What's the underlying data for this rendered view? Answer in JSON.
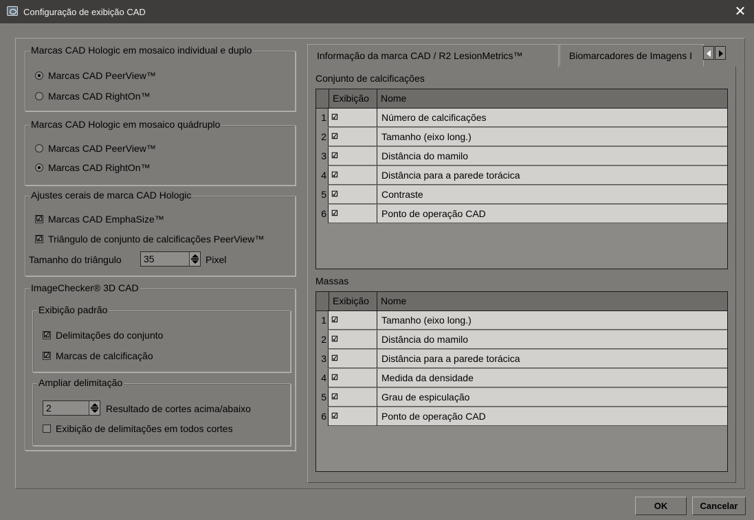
{
  "window": {
    "title": "Configuração de exibição CAD",
    "close": "✕"
  },
  "left": {
    "group1": {
      "legend": "Marcas CAD Hologic em mosaico individual e duplo",
      "options": [
        {
          "label": "Marcas CAD PeerView™",
          "selected": true
        },
        {
          "label": "Marcas CAD RightOn™",
          "selected": false
        }
      ]
    },
    "group2": {
      "legend": "Marcas CAD Hologic em mosaico quádruplo",
      "options": [
        {
          "label": "Marcas CAD PeerView™",
          "selected": false
        },
        {
          "label": "Marcas CAD RightOn™",
          "selected": true
        }
      ]
    },
    "group3": {
      "legend": "Ajustes cerais de marca CAD Hologic",
      "emphasize": "Marcas CAD EmphaSize™",
      "triangle": "Triângulo de conjunto de calcificações PeerView™",
      "size_label": "Tamanho do triângulo",
      "size_value": "35",
      "size_unit": "Pixel"
    },
    "group4": {
      "legend": "ImageChecker® 3D CAD",
      "display": {
        "legend": "Exibição padrão",
        "bounds": "Delimitações do conjunto",
        "calc_marks": "Marcas de calcificação"
      },
      "expand": {
        "legend": "Ampliar delimitação",
        "slices_value": "2",
        "slices_label": "Resultado de cortes acima/abaixo",
        "all_slices": "Exibição de delimitações em todos cortes"
      }
    }
  },
  "tabs": [
    {
      "label": "Informação da marca CAD / R2 LesionMetrics™"
    },
    {
      "label": "Biomarcadores de Imagens I"
    }
  ],
  "calc": {
    "title": "Conjunto de calcificações",
    "headers": [
      "Exibição",
      "Nome"
    ],
    "rows": [
      {
        "num": "1",
        "check": "☑",
        "name": "Número de calcificações"
      },
      {
        "num": "2",
        "check": "☑",
        "name": "Tamanho (eixo long.)"
      },
      {
        "num": "3",
        "check": "☑",
        "name": "Distância do mamilo"
      },
      {
        "num": "4",
        "check": "☑",
        "name": "Distância para a parede torácica"
      },
      {
        "num": "5",
        "check": "☑",
        "name": "Contraste"
      },
      {
        "num": "6",
        "check": "☑",
        "name": "Ponto de operação CAD"
      }
    ]
  },
  "mass": {
    "title": "Massas",
    "headers": [
      "Exibição",
      "Nome"
    ],
    "rows": [
      {
        "num": "1",
        "check": "☑",
        "name": "Tamanho (eixo long.)"
      },
      {
        "num": "2",
        "check": "☑",
        "name": "Distância do mamilo"
      },
      {
        "num": "3",
        "check": "☑",
        "name": "Distância para a parede torácica"
      },
      {
        "num": "4",
        "check": "☑",
        "name": "Medida da densidade"
      },
      {
        "num": "5",
        "check": "☑",
        "name": "Grau de espiculação"
      },
      {
        "num": "6",
        "check": "☑",
        "name": "Ponto de operação CAD"
      }
    ]
  },
  "buttons": {
    "ok": "OK",
    "cancel": "Cancelar"
  },
  "check_glyph": "☑"
}
